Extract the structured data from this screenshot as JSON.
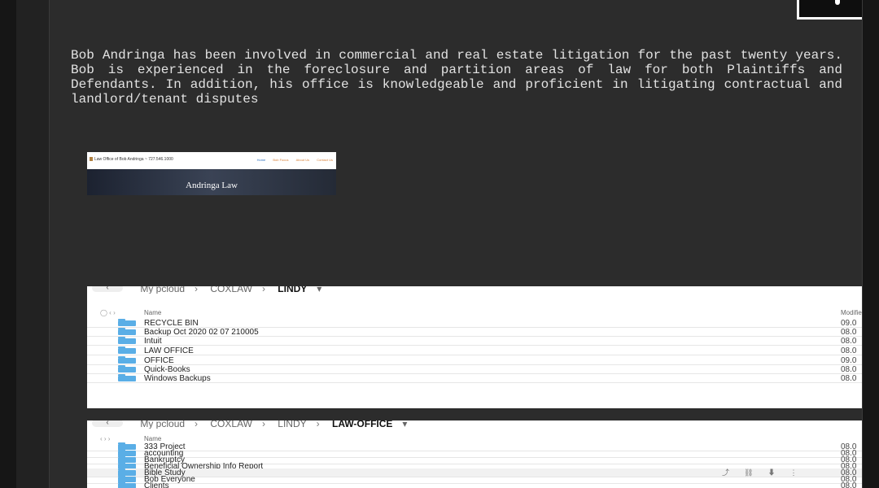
{
  "bio_text": "Bob Andringa has been involved in commercial and real estate litigation for the past twenty years. Bob is experienced in the foreclosure and partition areas of law for both Plaintiffs and Defendants. In addition, his office is knowledgeable and proficient in litigating contractual and landlord/tenant disputes",
  "site_thumb": {
    "brand": "Law Office of Bob Andringa ~ 727.546.1000",
    "nav": [
      "Home",
      "Bob Focus",
      "About Us",
      "Contact Us"
    ],
    "hero_title": "Andringa Law"
  },
  "cloud_1": {
    "breadcrumb": [
      "My pcloud",
      "COXLAW",
      "LINDY"
    ],
    "col_name": "Name",
    "col_modified": "Modified",
    "rows": [
      {
        "name": "RECYCLE BIN",
        "date": "09.0"
      },
      {
        "name": "Backup Oct 2020 02 07 210005",
        "date": "08.0"
      },
      {
        "name": "Intuit",
        "date": "08.0"
      },
      {
        "name": "LAW OFFICE",
        "date": "08.0"
      },
      {
        "name": "OFFICE",
        "date": "09.0"
      },
      {
        "name": "Quick-Books",
        "date": "08.0"
      },
      {
        "name": "Windows Backups",
        "date": "08.0"
      }
    ]
  },
  "cloud_2": {
    "breadcrumb": [
      "My pcloud",
      "COXLAW",
      "LINDY",
      "LAW-OFFICE"
    ],
    "col_name": "Name",
    "rows": [
      {
        "name": "333 Project",
        "date": "08.0"
      },
      {
        "name": "accounting",
        "date": "08.0"
      },
      {
        "name": "Bankruptcy",
        "date": "08.0"
      },
      {
        "name": "Beneficial Ownership Info Report",
        "date": "08.0"
      },
      {
        "name": "Bible Study",
        "date": "08.0"
      },
      {
        "name": "Bob Everyone",
        "date": "08.0"
      },
      {
        "name": "Clients",
        "date": "08.0"
      }
    ]
  },
  "colors": {
    "page_bg": "#2c2c2c",
    "text": "#e2e2e2",
    "folder": "#5aaee6"
  }
}
